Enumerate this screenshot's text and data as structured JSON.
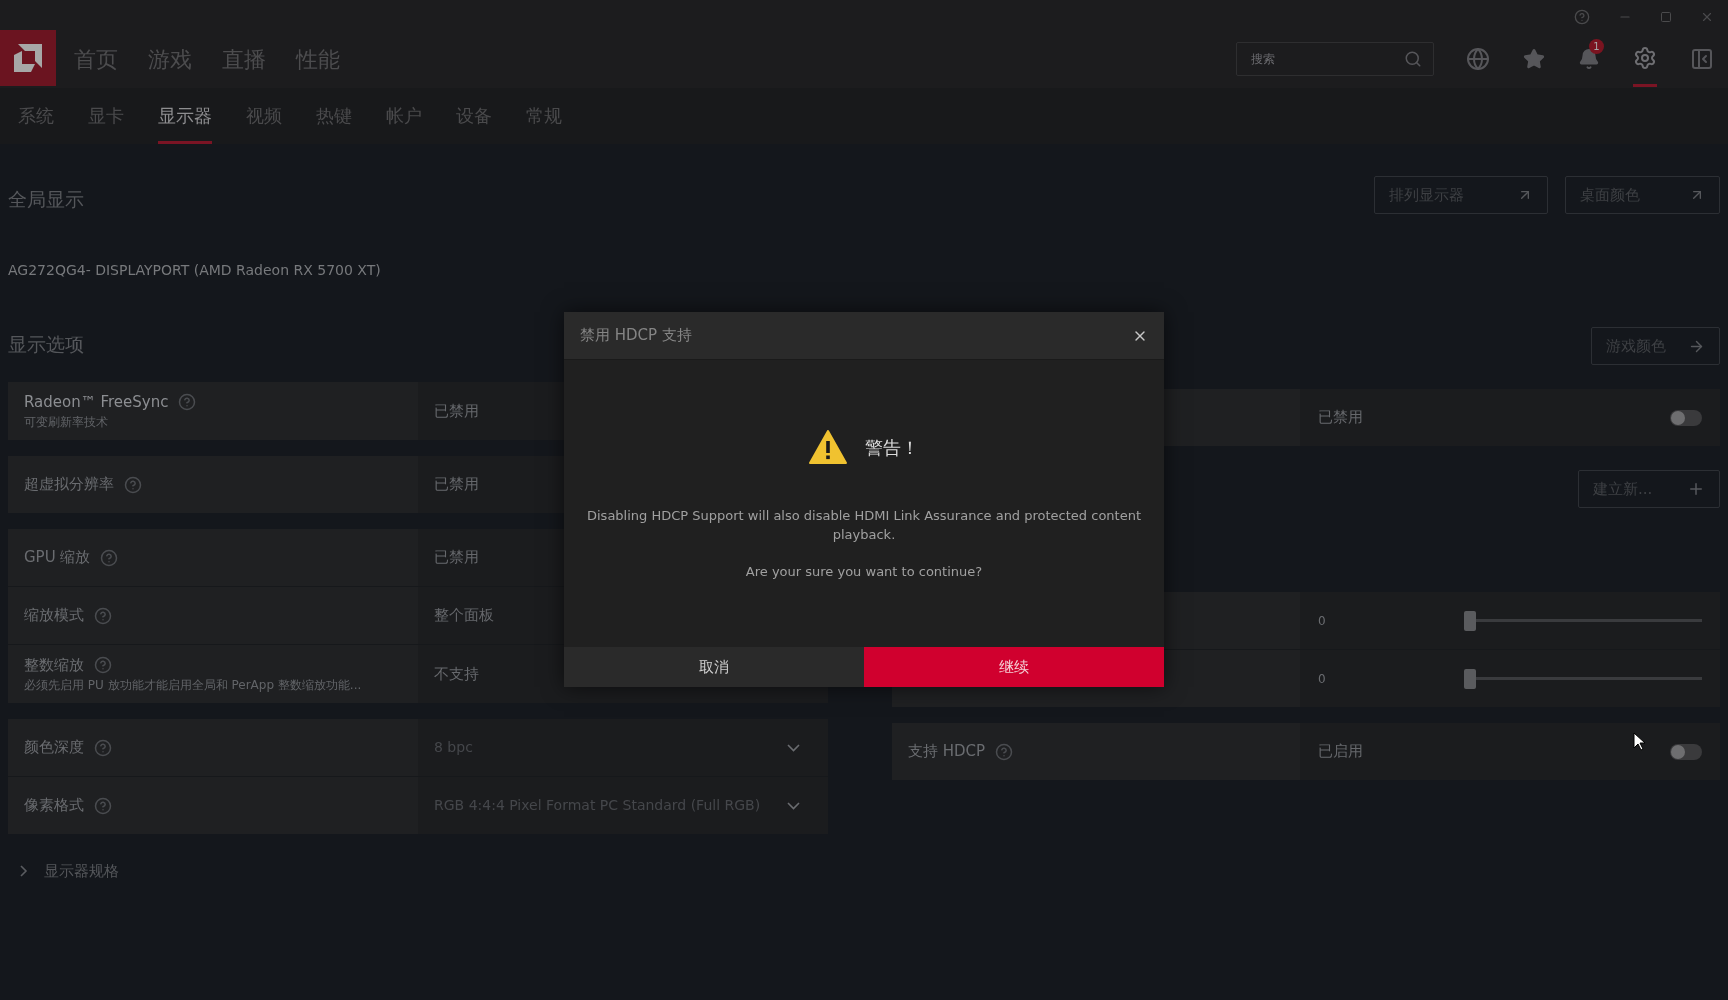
{
  "nav": {
    "items": [
      {
        "label": "首页",
        "selected": false
      },
      {
        "label": "游戏",
        "selected": false
      },
      {
        "label": "直播",
        "selected": false
      },
      {
        "label": "性能",
        "selected": false
      }
    ]
  },
  "search": {
    "placeholder": "搜索"
  },
  "notifications": {
    "count": "1"
  },
  "settings": {
    "selected": true
  },
  "subtabs": [
    {
      "label": "系统",
      "selected": false
    },
    {
      "label": "显卡",
      "selected": false
    },
    {
      "label": "显示器",
      "selected": true
    },
    {
      "label": "视频",
      "selected": false
    },
    {
      "label": "热键",
      "selected": false
    },
    {
      "label": "帐户",
      "selected": false
    },
    {
      "label": "设备",
      "selected": false
    },
    {
      "label": "常规",
      "selected": false
    }
  ],
  "global_display": {
    "title": "全局显示",
    "buttons": [
      "排列显示器",
      "桌面颜色"
    ]
  },
  "monitor_name": "AG272QG4- DISPLAYPORT (AMD Radeon RX 5700 XT)",
  "display_options": {
    "title": "显示选项",
    "groups": [
      [
        {
          "label": "Radeon™ FreeSync",
          "sublabel": "可变刷新率技术",
          "value": "已禁用",
          "kind": "text"
        }
      ],
      [
        {
          "label": "超虚拟分辨率",
          "value": "已禁用",
          "kind": "text"
        }
      ],
      [
        {
          "label": "GPU 缩放",
          "value": "已禁用",
          "kind": "text"
        },
        {
          "label": "缩放模式",
          "value": "整个面板",
          "kind": "text"
        },
        {
          "label": "整数缩放",
          "sublabel": "必须先启用 PU 放功能才能启用全局和 PerApp 整数缩放功能...",
          "value": "不支持",
          "kind": "text"
        }
      ],
      [
        {
          "label": "颜色深度",
          "value": "8 bpc",
          "kind": "dropdown"
        },
        {
          "label": "像素格式",
          "value": "RGB 4:4:4 Pixel Format PC Standard (Full RGB)",
          "kind": "dropdown"
        }
      ]
    ]
  },
  "right_panel": {
    "game_color_button": "游戏颜色",
    "groups": [
      [
        {
          "kind": "toggle",
          "value": "已禁用",
          "on": false
        }
      ],
      [
        {
          "kind": "button",
          "value": "建立新..."
        }
      ],
      [
        {
          "kind": "slider",
          "value": "0",
          "level": 0
        },
        {
          "kind": "slider",
          "value": "0",
          "level": 0
        }
      ],
      [
        {
          "kind": "toggle",
          "label": "支持 HDCP",
          "value": "已启用",
          "on": false
        }
      ]
    ]
  },
  "display_specs": {
    "label": "显示器规格",
    "expanded": false
  },
  "dialog": {
    "title": "禁用 HDCP 支持",
    "heading": "警告！",
    "message": "Disabling HDCP Support will also disable HDMI Link Assurance and protected content playback.",
    "question": "Are your sure you want to continue?",
    "cancel": "取消",
    "confirm": "继续"
  }
}
